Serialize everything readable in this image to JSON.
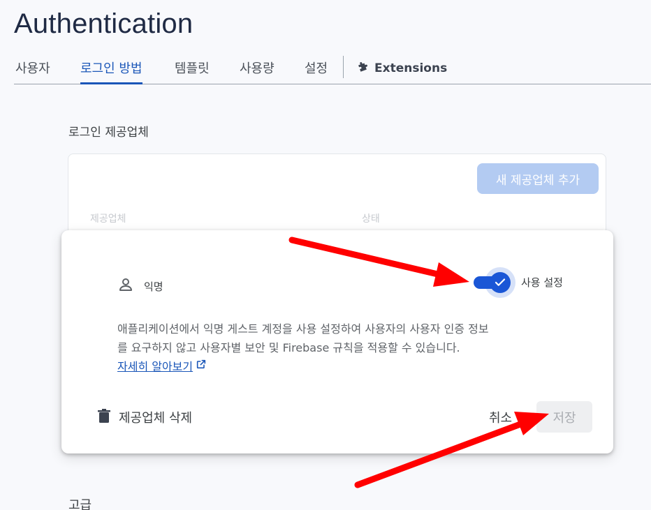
{
  "header": {
    "title": "Authentication"
  },
  "tabs": [
    {
      "label": "사용자"
    },
    {
      "label": "로그인 방법"
    },
    {
      "label": "템플릿"
    },
    {
      "label": "사용량"
    },
    {
      "label": "설정"
    }
  ],
  "extensions_tab": {
    "label": "Extensions",
    "icon": "puzzle-icon"
  },
  "providers_section": {
    "title": "로그인 제공업체",
    "add_button": "새 제공업체 추가",
    "columns": [
      "제공업체",
      "상태"
    ]
  },
  "dialog": {
    "provider_name": "익명",
    "provider_icon": "person-icon",
    "toggle_label": "사용 설정",
    "toggle_on": true,
    "description_line1": "애플리케이션에서 익명 게스트 계정을 사용 설정하여 사용자의 사용자 인증 정보",
    "description_line2": "를 요구하지 않고 사용자별 보안 및 Firebase 규칙을 적용할 수 있습니다.",
    "learn_more": "자세히 알아보기",
    "delete_label": "제공업체 삭제",
    "cancel_label": "취소",
    "save_label": "저장"
  },
  "advanced_section": {
    "title": "고급"
  },
  "colors": {
    "accent": "#1a56d6",
    "annotation_arrow": "#ff0000"
  }
}
